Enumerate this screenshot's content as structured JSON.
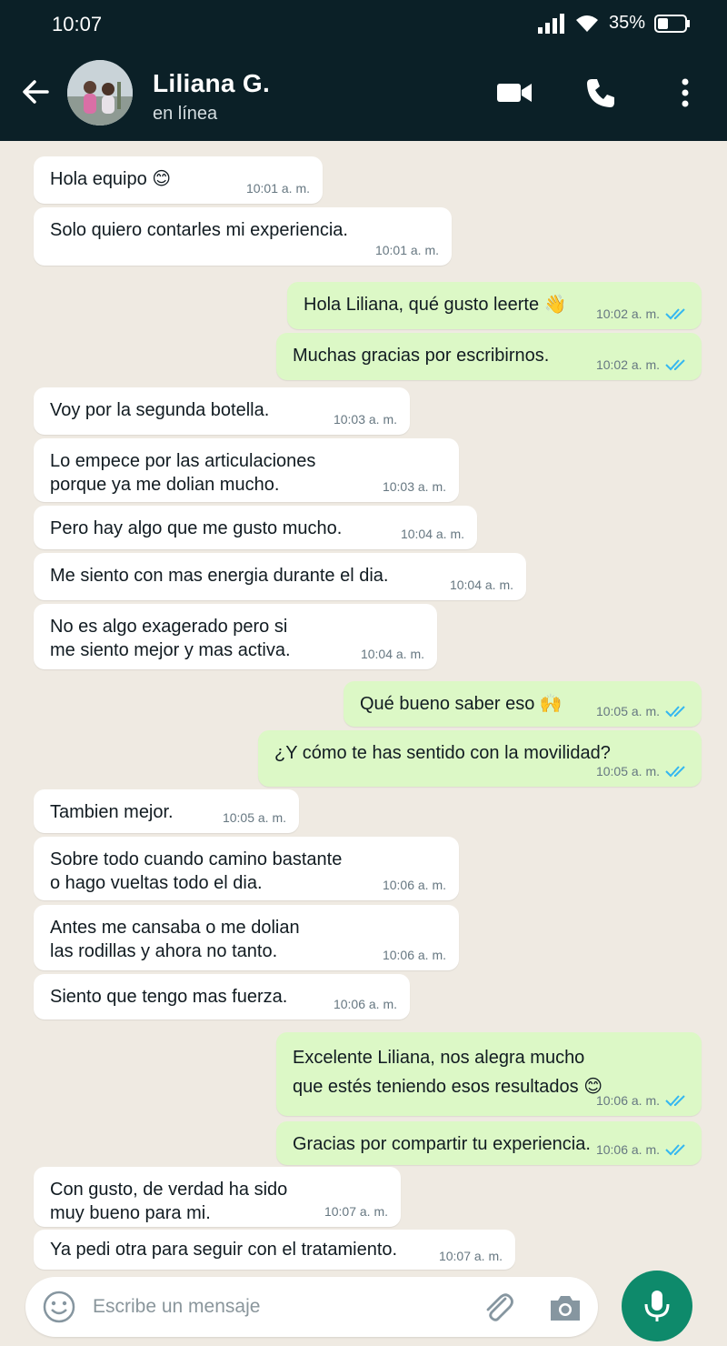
{
  "status_bar": {
    "time": "10:07",
    "battery": "35%"
  },
  "header": {
    "contact_name": "Liliana G.",
    "contact_status": "en línea"
  },
  "colors": {
    "header_bg": "#0b2027",
    "chat_bg": "#efeae2",
    "outgoing_bubble": "#dcf8c6",
    "incoming_bubble": "#ffffff",
    "read_ticks": "#34b7f1",
    "mic_button": "#0e8a6b"
  },
  "messages": [
    {
      "dir": "in",
      "text": "Hola equipo 😊",
      "time": "10:01 a. m."
    },
    {
      "dir": "in",
      "text": "Solo quiero contarles mi experiencia.",
      "time": "10:01 a. m."
    },
    {
      "dir": "out",
      "text": "Hola Liliana, qué gusto leerte 👋",
      "time": "10:02 a. m."
    },
    {
      "dir": "out",
      "text": "Muchas gracias por escribirnos.",
      "time": "10:02 a. m."
    },
    {
      "dir": "in",
      "text": "Voy por la segunda botella.",
      "time": "10:03 a. m."
    },
    {
      "dir": "in",
      "text": "Lo empece por las articulaciones\nporque ya me dolian mucho.",
      "time": "10:03 a. m."
    },
    {
      "dir": "in",
      "text": "Pero hay algo que me gusto mucho.",
      "time": "10:04 a. m."
    },
    {
      "dir": "in",
      "text": "Me siento con mas energia durante el dia.",
      "time": "10:04 a. m."
    },
    {
      "dir": "in",
      "text": "No es algo exagerado pero si\nme siento mejor y mas activa.",
      "time": "10:04 a. m."
    },
    {
      "dir": "out",
      "text": "Qué bueno saber eso 🙌",
      "time": "10:05 a. m."
    },
    {
      "dir": "out",
      "text": "¿Y cómo te has sentido con la movilidad?",
      "time": "10:05 a. m."
    },
    {
      "dir": "in",
      "text": "Tambien mejor.",
      "time": "10:05 a. m."
    },
    {
      "dir": "in",
      "text": "Sobre todo cuando camino bastante\no hago vueltas todo el dia.",
      "time": "10:06 a. m."
    },
    {
      "dir": "in",
      "text": "Antes me cansaba o me dolian\nlas rodillas y ahora no tanto.",
      "time": "10:06 a. m."
    },
    {
      "dir": "in",
      "text": "Siento que tengo mas fuerza.",
      "time": "10:06 a. m."
    },
    {
      "dir": "out",
      "text": "Excelente Liliana, nos alegra mucho\nque estés teniendo esos resultados 😊",
      "time": "10:06 a. m."
    },
    {
      "dir": "out",
      "text": "Gracias por compartir tu experiencia.",
      "time": "10:06 a. m."
    },
    {
      "dir": "in",
      "text": "Con gusto, de verdad ha sido\nmuy bueno para mi.",
      "time": "10:07 a. m."
    },
    {
      "dir": "in",
      "text": "Ya pedi otra para seguir con el tratamiento.",
      "time": "10:07 a. m."
    }
  ],
  "composer": {
    "placeholder": "Escribe un mensaje",
    "emoji_icon": "smiley-icon",
    "attach_icon": "paperclip-icon",
    "camera_icon": "camera-icon",
    "mic_icon": "microphone-icon"
  }
}
